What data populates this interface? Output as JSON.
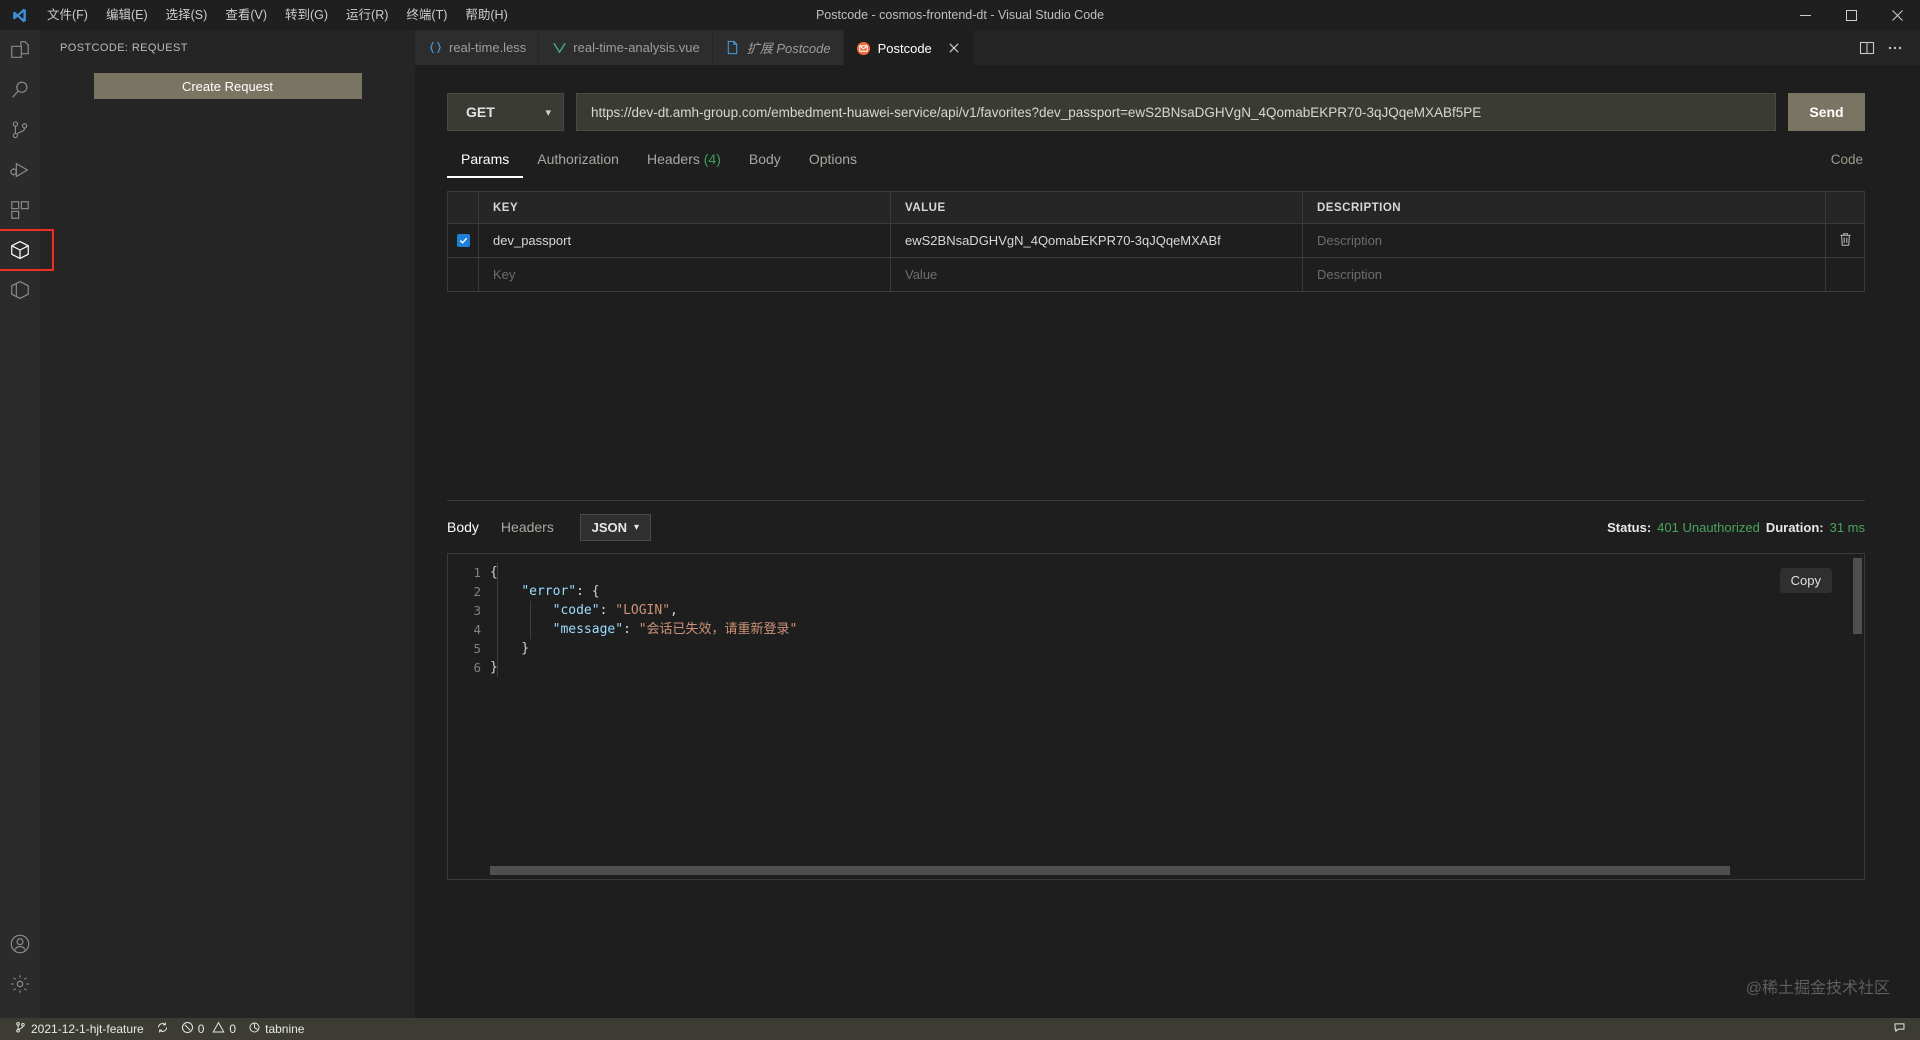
{
  "titlebar": {
    "title": "Postcode - cosmos-frontend-dt - Visual Studio Code",
    "menus": [
      "文件(F)",
      "编辑(E)",
      "选择(S)",
      "查看(V)",
      "转到(G)",
      "运行(R)",
      "终端(T)",
      "帮助(H)"
    ],
    "window_controls": [
      "minimize-icon",
      "maximize-icon",
      "close-icon"
    ]
  },
  "activitybar": {
    "items": [
      {
        "name": "explorer",
        "icon": "files-icon"
      },
      {
        "name": "search",
        "icon": "search-icon"
      },
      {
        "name": "source-control",
        "icon": "source-control-icon"
      },
      {
        "name": "run-and-debug",
        "icon": "run-debug-icon"
      },
      {
        "name": "extensions",
        "icon": "extensions-icon"
      },
      {
        "name": "postcode",
        "icon": "package-icon"
      },
      {
        "name": "misc",
        "icon": "hexagon-icon"
      }
    ],
    "bottom": [
      {
        "name": "accounts",
        "icon": "account-icon"
      },
      {
        "name": "settings",
        "icon": "gear-icon"
      }
    ]
  },
  "sidebar": {
    "title": "POSTCODE: REQUEST",
    "create_request_label": "Create Request"
  },
  "tabs": [
    {
      "label": "real-time.less",
      "icon": "less-icon",
      "active": false,
      "closable": false,
      "prefix": ""
    },
    {
      "label": "real-time-analysis.vue",
      "icon": "vue-icon",
      "active": false,
      "closable": false,
      "prefix": ""
    },
    {
      "label": "Postcode",
      "icon": "file-icon",
      "active": false,
      "closable": false,
      "prefix": "扩展",
      "italic": true
    },
    {
      "label": "Postcode",
      "icon": "postcode-icon",
      "active": true,
      "closable": true,
      "prefix": ""
    }
  ],
  "tab_actions": [
    {
      "name": "split-editor-icon"
    },
    {
      "name": "more-actions-icon"
    }
  ],
  "request": {
    "method": "GET",
    "method_chevron": "chevron-down-icon",
    "url": "https://dev-dt.amh-group.com/embedment-huawei-service/api/v1/favorites?dev_passport=ewS2BNsaDGHVgN_4QomabEKPR70-3qJQqeMXABf5PE",
    "send_label": "Send",
    "code_label": "Code",
    "tabs": [
      {
        "label": "Params",
        "count": "",
        "active": true
      },
      {
        "label": "Authorization",
        "count": "",
        "active": false
      },
      {
        "label": "Headers",
        "count": "(4)",
        "active": false
      },
      {
        "label": "Body",
        "count": "",
        "active": false
      },
      {
        "label": "Options",
        "count": "",
        "active": false
      }
    ],
    "table": {
      "headers": [
        "KEY",
        "VALUE",
        "DESCRIPTION"
      ],
      "rows": [
        {
          "checked": true,
          "key": "dev_passport",
          "value": "ewS2BNsaDGHVgN_4QomabEKPR70-3qJQqeMXABf",
          "description": "",
          "description_placeholder": "Description",
          "delete_icon": "trash-icon"
        }
      ],
      "empty_row": {
        "key_placeholder": "Key",
        "value_placeholder": "Value",
        "description_placeholder": "Description"
      }
    }
  },
  "response": {
    "tabs": [
      {
        "label": "Body",
        "active": true
      },
      {
        "label": "Headers",
        "active": false
      }
    ],
    "format": "JSON",
    "format_chevron": "chevron-down-icon",
    "status_label": "Status:",
    "status_value": "401 Unauthorized",
    "duration_label": "Duration:",
    "duration_value": "31 ms",
    "copy_label": "Copy",
    "line_numbers": [
      "1",
      "2",
      "3",
      "4",
      "5",
      "6"
    ],
    "code_lines": [
      [
        {
          "t": "{",
          "c": "brace"
        }
      ],
      [
        {
          "t": "    ",
          "c": "plain"
        },
        {
          "t": "\"error\"",
          "c": "key"
        },
        {
          "t": ": {",
          "c": "plain"
        }
      ],
      [
        {
          "t": "        ",
          "c": "plain"
        },
        {
          "t": "\"code\"",
          "c": "key"
        },
        {
          "t": ": ",
          "c": "plain"
        },
        {
          "t": "\"LOGIN\"",
          "c": "str"
        },
        {
          "t": ",",
          "c": "plain"
        }
      ],
      [
        {
          "t": "        ",
          "c": "plain"
        },
        {
          "t": "\"message\"",
          "c": "key"
        },
        {
          "t": ": ",
          "c": "plain"
        },
        {
          "t": "\"会话已失效，请重新登录\"",
          "c": "str"
        }
      ],
      [
        {
          "t": "    }",
          "c": "plain"
        }
      ],
      [
        {
          "t": "}",
          "c": "brace"
        }
      ]
    ]
  },
  "watermark": "@稀土掘金技术社区",
  "statusbar": {
    "branch": "2021-12-1-hjt-feature",
    "branch_icon": "source-control-icon",
    "sync_icon": "sync-icon",
    "errors": "0",
    "error_icon": "error-icon",
    "warnings": "0",
    "warning_icon": "warning-icon",
    "tabnine": "tabnine",
    "tabnine_icon": "tabnine-icon",
    "feedback_icon": "feedback-icon"
  },
  "colors": {
    "accent_button": "#7a7463",
    "status_green": "#4aa35c",
    "highlight_box": "#f02f22",
    "checkbox_blue": "#1e7fd8"
  }
}
